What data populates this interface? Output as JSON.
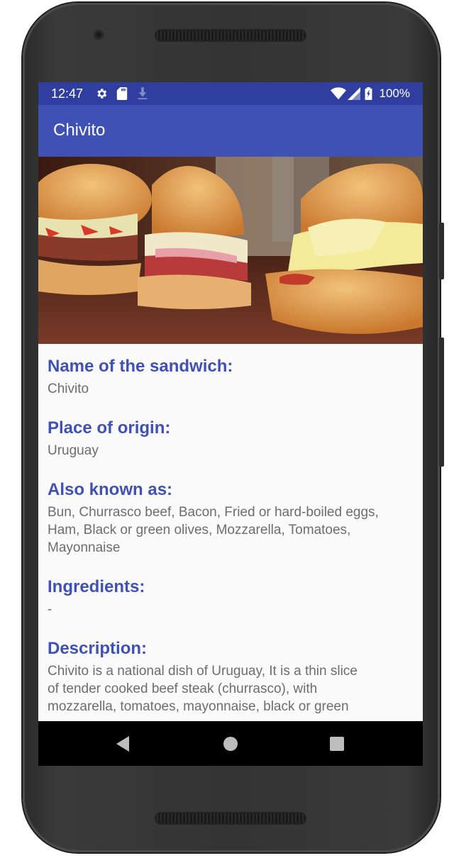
{
  "status_bar": {
    "time": "12:47",
    "battery": "100%",
    "icons": [
      "settings-icon",
      "sd-card-icon",
      "download-icon",
      "wifi-icon",
      "signal-icon",
      "battery-icon"
    ]
  },
  "app_bar": {
    "title": "Chivito"
  },
  "hero_image": {
    "subject": "chivito sandwiches photo"
  },
  "fields": [
    {
      "label": "Name of the sandwich:",
      "value": "Chivito"
    },
    {
      "label": "Place of origin:",
      "value": "Uruguay"
    },
    {
      "label": "Also known as:",
      "value": "Bun, Churrasco beef, Bacon, Fried or hard-boiled eggs, Ham, Black or green olives, Mozzarella, Tomatoes, Mayonnaise"
    },
    {
      "label": "Ingredients:",
      "value": "-"
    },
    {
      "label": "Description:",
      "value": "Chivito is a national dish of Uruguay, It is a thin slice of tender cooked beef steak (churrasco), with mozzarella, tomatoes, mayonnaise, black or green"
    }
  ],
  "nav_bar": {
    "icons": [
      "back-icon",
      "home-icon",
      "recents-icon"
    ]
  },
  "colors": {
    "status_bar": "#303f9f",
    "app_bar": "#3f51b5",
    "accent_label": "#3f51b5",
    "body_text": "#6d6d6d",
    "nav_bar": "#000000"
  }
}
